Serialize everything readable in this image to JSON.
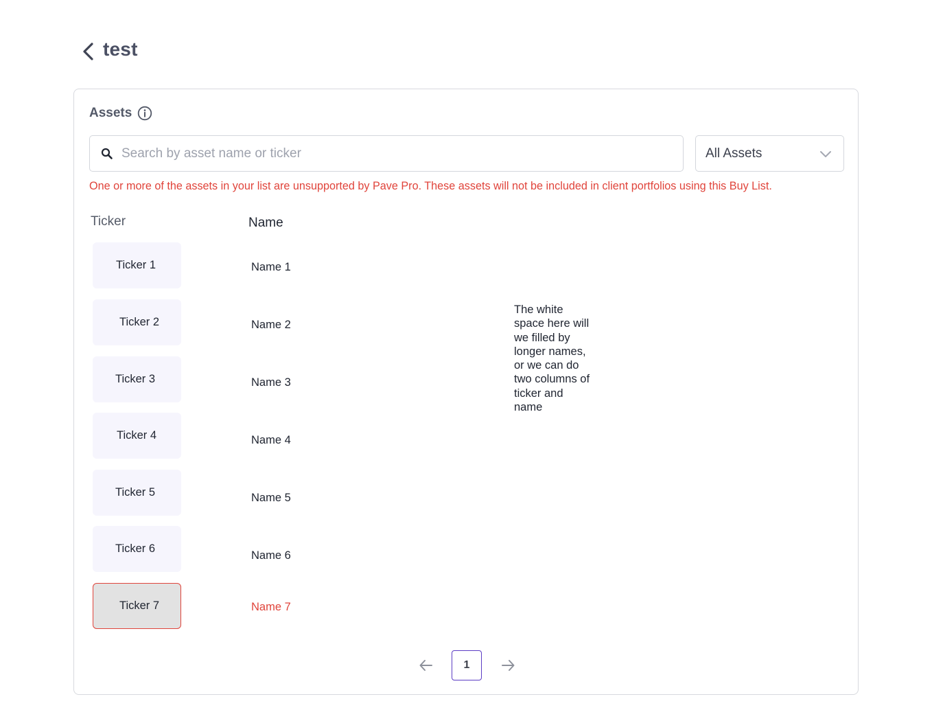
{
  "header": {
    "title": "test"
  },
  "assets": {
    "title": "Assets",
    "search": {
      "placeholder": "Search by asset name or ticker",
      "value": ""
    },
    "filter": {
      "selected": "All Assets"
    },
    "warning": "One or more of the assets in your list are unsupported by Pave Pro. These assets will not be included in client portfolios using this Buy List.",
    "columns": {
      "ticker": "Ticker",
      "name": "Name"
    },
    "rows": [
      {
        "ticker": "Ticker 1",
        "name": "Name 1",
        "unsupported": false
      },
      {
        "ticker": "Ticker 2",
        "name": "Name 2",
        "unsupported": false
      },
      {
        "ticker": "Ticker 3",
        "name": "Name 3",
        "unsupported": false
      },
      {
        "ticker": "Ticker 4",
        "name": "Name 4",
        "unsupported": false
      },
      {
        "ticker": "Ticker 5",
        "name": "Name 5",
        "unsupported": false
      },
      {
        "ticker": "Ticker 6",
        "name": "Name 6",
        "unsupported": false
      },
      {
        "ticker": "Ticker 7",
        "name": "Name 7",
        "unsupported": true
      }
    ],
    "note": "The white space here will we filled by longer names, or we can do two columns of ticker and name"
  },
  "pagination": {
    "current_page": "1"
  },
  "colors": {
    "accent": "#5b3cc4",
    "error": "#e0443b",
    "chip_background": "#f6f5fd",
    "chip_error_background": "#e2e2e2"
  },
  "icons": {
    "back": "chevron-left-icon",
    "info": "info-icon",
    "search": "search-icon",
    "dropdown": "chevron-down-icon",
    "prev": "arrow-left-icon",
    "next": "arrow-right-icon"
  }
}
